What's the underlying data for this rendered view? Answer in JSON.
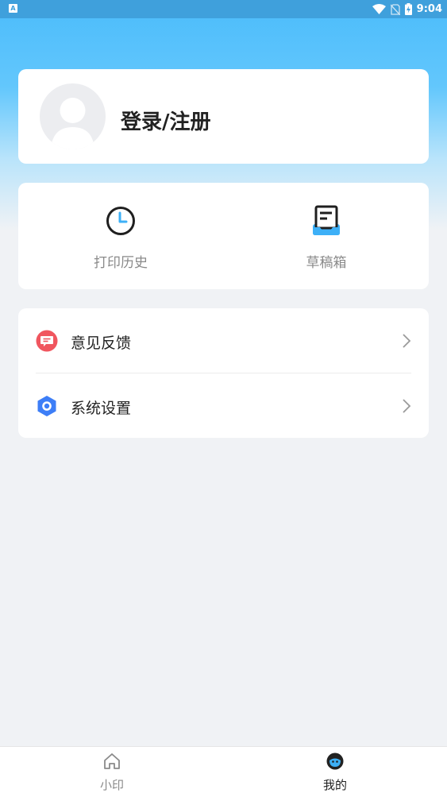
{
  "status_bar": {
    "time": "9:04",
    "app_badge": "A",
    "icons": [
      "wifi-icon",
      "no-sim-icon",
      "battery-charging-icon"
    ]
  },
  "profile": {
    "login_label": "登录/注册",
    "avatar_icon": "default-avatar-icon"
  },
  "quick_actions": [
    {
      "label": "打印历史",
      "icon": "clock-icon"
    },
    {
      "label": "草稿箱",
      "icon": "drafts-box-icon"
    }
  ],
  "menu": [
    {
      "label": "意见反馈",
      "icon": "feedback-icon",
      "icon_color": "#f0565f"
    },
    {
      "label": "系统设置",
      "icon": "settings-hexagon-icon",
      "icon_color": "#3d7ef7"
    }
  ],
  "tabbar": {
    "tabs": [
      {
        "label": "小印",
        "icon": "home-icon",
        "active": false
      },
      {
        "label": "我的",
        "icon": "profile-face-icon",
        "active": true
      }
    ],
    "active_color": "#222222",
    "inactive_color": "#8a8a8a"
  },
  "colors": {
    "header_blue": "#4bbcfb",
    "status_bar": "#3fa0dc",
    "background": "#f0f2f5"
  }
}
